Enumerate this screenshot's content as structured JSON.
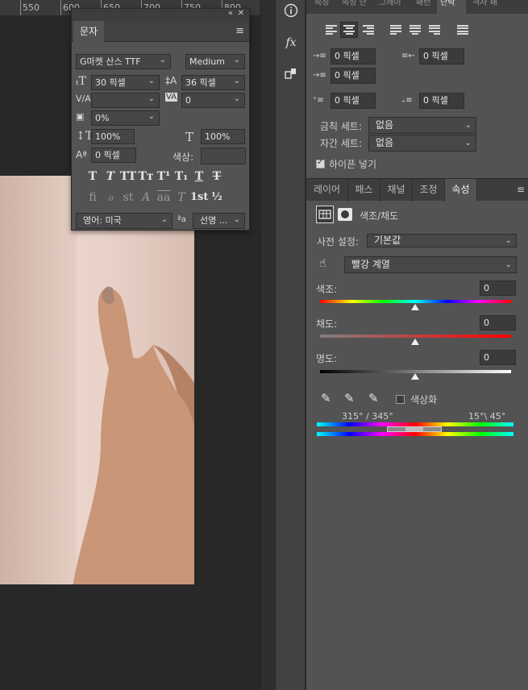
{
  "ruler": {
    "labels": [
      "550",
      "600",
      "650",
      "700",
      "750",
      "800"
    ]
  },
  "character_panel": {
    "tab": "문자",
    "font_family": "G마켓 산스 TTF",
    "font_style": "Medium",
    "font_size": "30 픽셀",
    "leading": "36 픽셀",
    "kerning": "",
    "tracking": "0",
    "tsume": "0%",
    "vertical_scale": "100%",
    "horizontal_scale": "100%",
    "baseline_shift": "0 픽셀",
    "color_label": "색상:",
    "glyph_buttons": [
      "T",
      "T",
      "TT",
      "Tт",
      "T¹",
      "T₁",
      "T",
      "T"
    ],
    "opentype_buttons": [
      "ﬁ",
      "ℴ",
      "st",
      "A",
      "aa",
      "T",
      "1st",
      "½"
    ],
    "language": "영어: 미국",
    "aa_label": "ªa",
    "antialias": "선명 ..."
  },
  "paragraph_panel": {
    "tabs": [
      "속성",
      "속성 단",
      "그레이",
      "패턴",
      "단락",
      "격자 패"
    ],
    "active_tab": "단락",
    "indent_left": "0 픽셀",
    "indent_right": "0 픽셀",
    "indent_first": "0 픽셀",
    "space_before": "0 픽셀",
    "space_after": "0 픽셀",
    "kinsoku_label": "금칙 세트:",
    "kinsoku_value": "없음",
    "mojikumi_label": "자간 세트:",
    "mojikumi_value": "없음",
    "hyphenate_label": "하이픈 넣기"
  },
  "layers_tabs": {
    "tabs": [
      "레이어",
      "패스",
      "채널",
      "조정",
      "속성"
    ],
    "active": "속성"
  },
  "properties": {
    "title": "색조/채도",
    "preset_label": "사전 설정:",
    "preset_value": "기본값",
    "range_value": "빨강 계열",
    "hue_label": "색조:",
    "hue_value": "0",
    "saturation_label": "채도:",
    "saturation_value": "0",
    "lightness_label": "명도:",
    "lightness_value": "0",
    "colorize_label": "색상화",
    "range_left": "315° / 345°",
    "range_right": "15°\\ 45°"
  },
  "colors": {
    "panel": "#535353",
    "dark": "#3d3d3d",
    "canvas": "#282828"
  }
}
